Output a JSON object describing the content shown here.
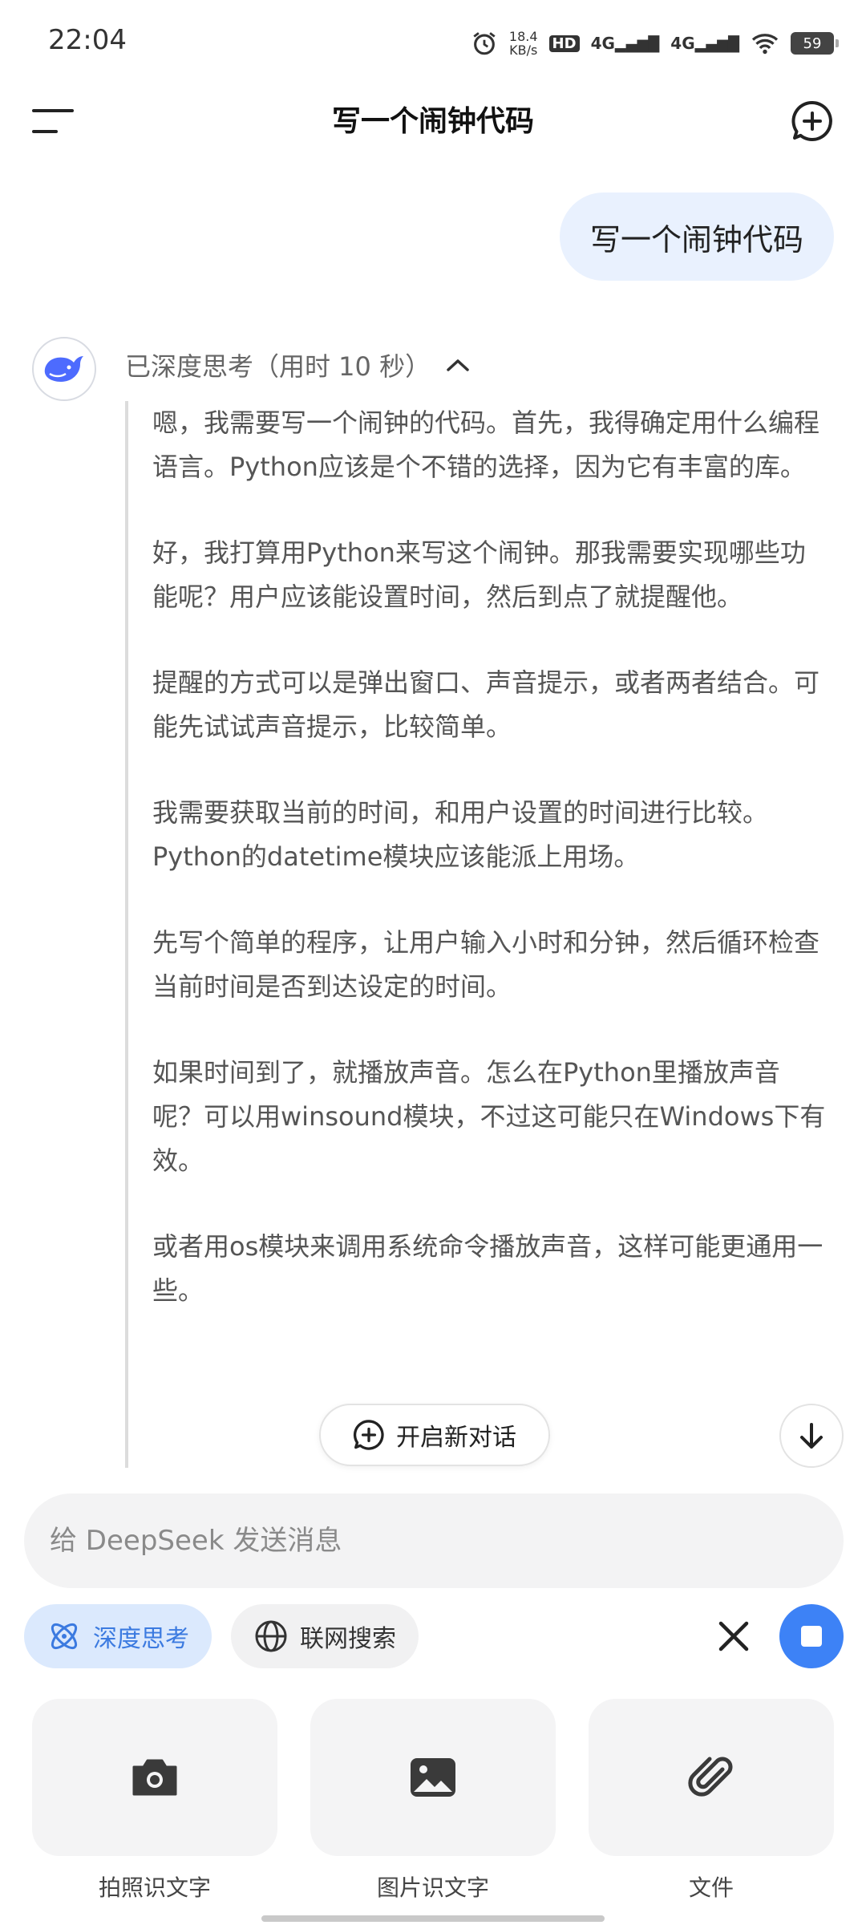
{
  "status_bar": {
    "time": "22:04",
    "net_speed_value": "18.4",
    "net_speed_unit": "KB/s",
    "hd_label": "HD",
    "sim1": "4G",
    "sim2": "4G",
    "battery": "59"
  },
  "header": {
    "title": "写一个闹钟代码",
    "menu_icon": "menu-icon",
    "new_chat_icon": "add-chat-icon"
  },
  "user_message": {
    "text": "写一个闹钟代码"
  },
  "assistant": {
    "think_label": "已深度思考（用时 10 秒）",
    "paragraphs": [
      "嗯，我需要写一个闹钟的代码。首先，我得确定用什么编程语言。Python应该是个不错的选择，因为它有丰富的库。",
      "好，我打算用Python来写这个闹钟。那我需要实现哪些功能呢？用户应该能设置时间，然后到点了就提醒他。",
      "提醒的方式可以是弹出窗口、声音提示，或者两者结合。可能先试试声音提示，比较简单。",
      "我需要获取当前的时间，和用户设置的时间进行比较。Python的datetime模块应该能派上用场。",
      "先写个简单的程序，让用户输入小时和分钟，然后循环检查当前时间是否到达设定的时间。",
      "如果时间到了，就播放声音。怎么在Python里播放声音呢？可以用winsound模块，不过这可能只在Windows下有效。",
      "或者用os模块来调用系统命令播放声音，这样可能更通用一些。"
    ]
  },
  "floating": {
    "new_dialog_label": "开启新对话"
  },
  "input": {
    "placeholder": "给 DeepSeek 发送消息"
  },
  "chips": {
    "deep_think": "深度思考",
    "web_search": "联网搜索"
  },
  "tools": [
    {
      "label": "拍照识文字",
      "icon": "camera-icon"
    },
    {
      "label": "图片识文字",
      "icon": "image-icon"
    },
    {
      "label": "文件",
      "icon": "paperclip-icon"
    }
  ],
  "colors": {
    "accent": "#3d82f6",
    "bubble": "#e9f1fe",
    "chip_active": "#dbe9fd"
  }
}
